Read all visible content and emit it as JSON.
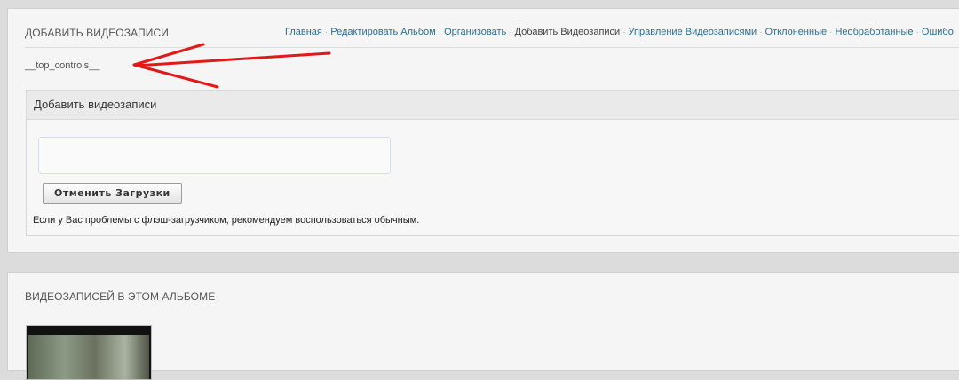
{
  "add_section": {
    "title": "ДОБАВИТЬ ВИДЕОЗАПИСИ",
    "nav": [
      {
        "label": "Главная",
        "current": false
      },
      {
        "label": "Редактировать Альбом",
        "current": false
      },
      {
        "label": "Организовать",
        "current": false
      },
      {
        "label": "Добавить Видеозаписи",
        "current": true
      },
      {
        "label": "Управление Видеозаписями",
        "current": false
      },
      {
        "label": "Отклоненные",
        "current": false
      },
      {
        "label": "Необработанные",
        "current": false
      },
      {
        "label": "Ошибо",
        "current": false
      }
    ],
    "top_controls": "__top_controls__",
    "annotation_color": "#e01919"
  },
  "upload_box": {
    "heading": "Добавить видеозаписи",
    "cancel_label": "Отменить Загрузки",
    "help_text": "Если у Вас проблемы с флэш-загрузчиком, рекомендуем воспользоваться обычным."
  },
  "videos_section": {
    "title": "ВИДЕОЗАПИСЕЙ В ЭТОМ АЛЬБОМЕ",
    "thumbnail_icon": "video-thumbnail"
  },
  "colors": {
    "link": "#2a6f8e",
    "panel_bg": "#f5f5f5",
    "page_bg": "#dcdcdc"
  }
}
